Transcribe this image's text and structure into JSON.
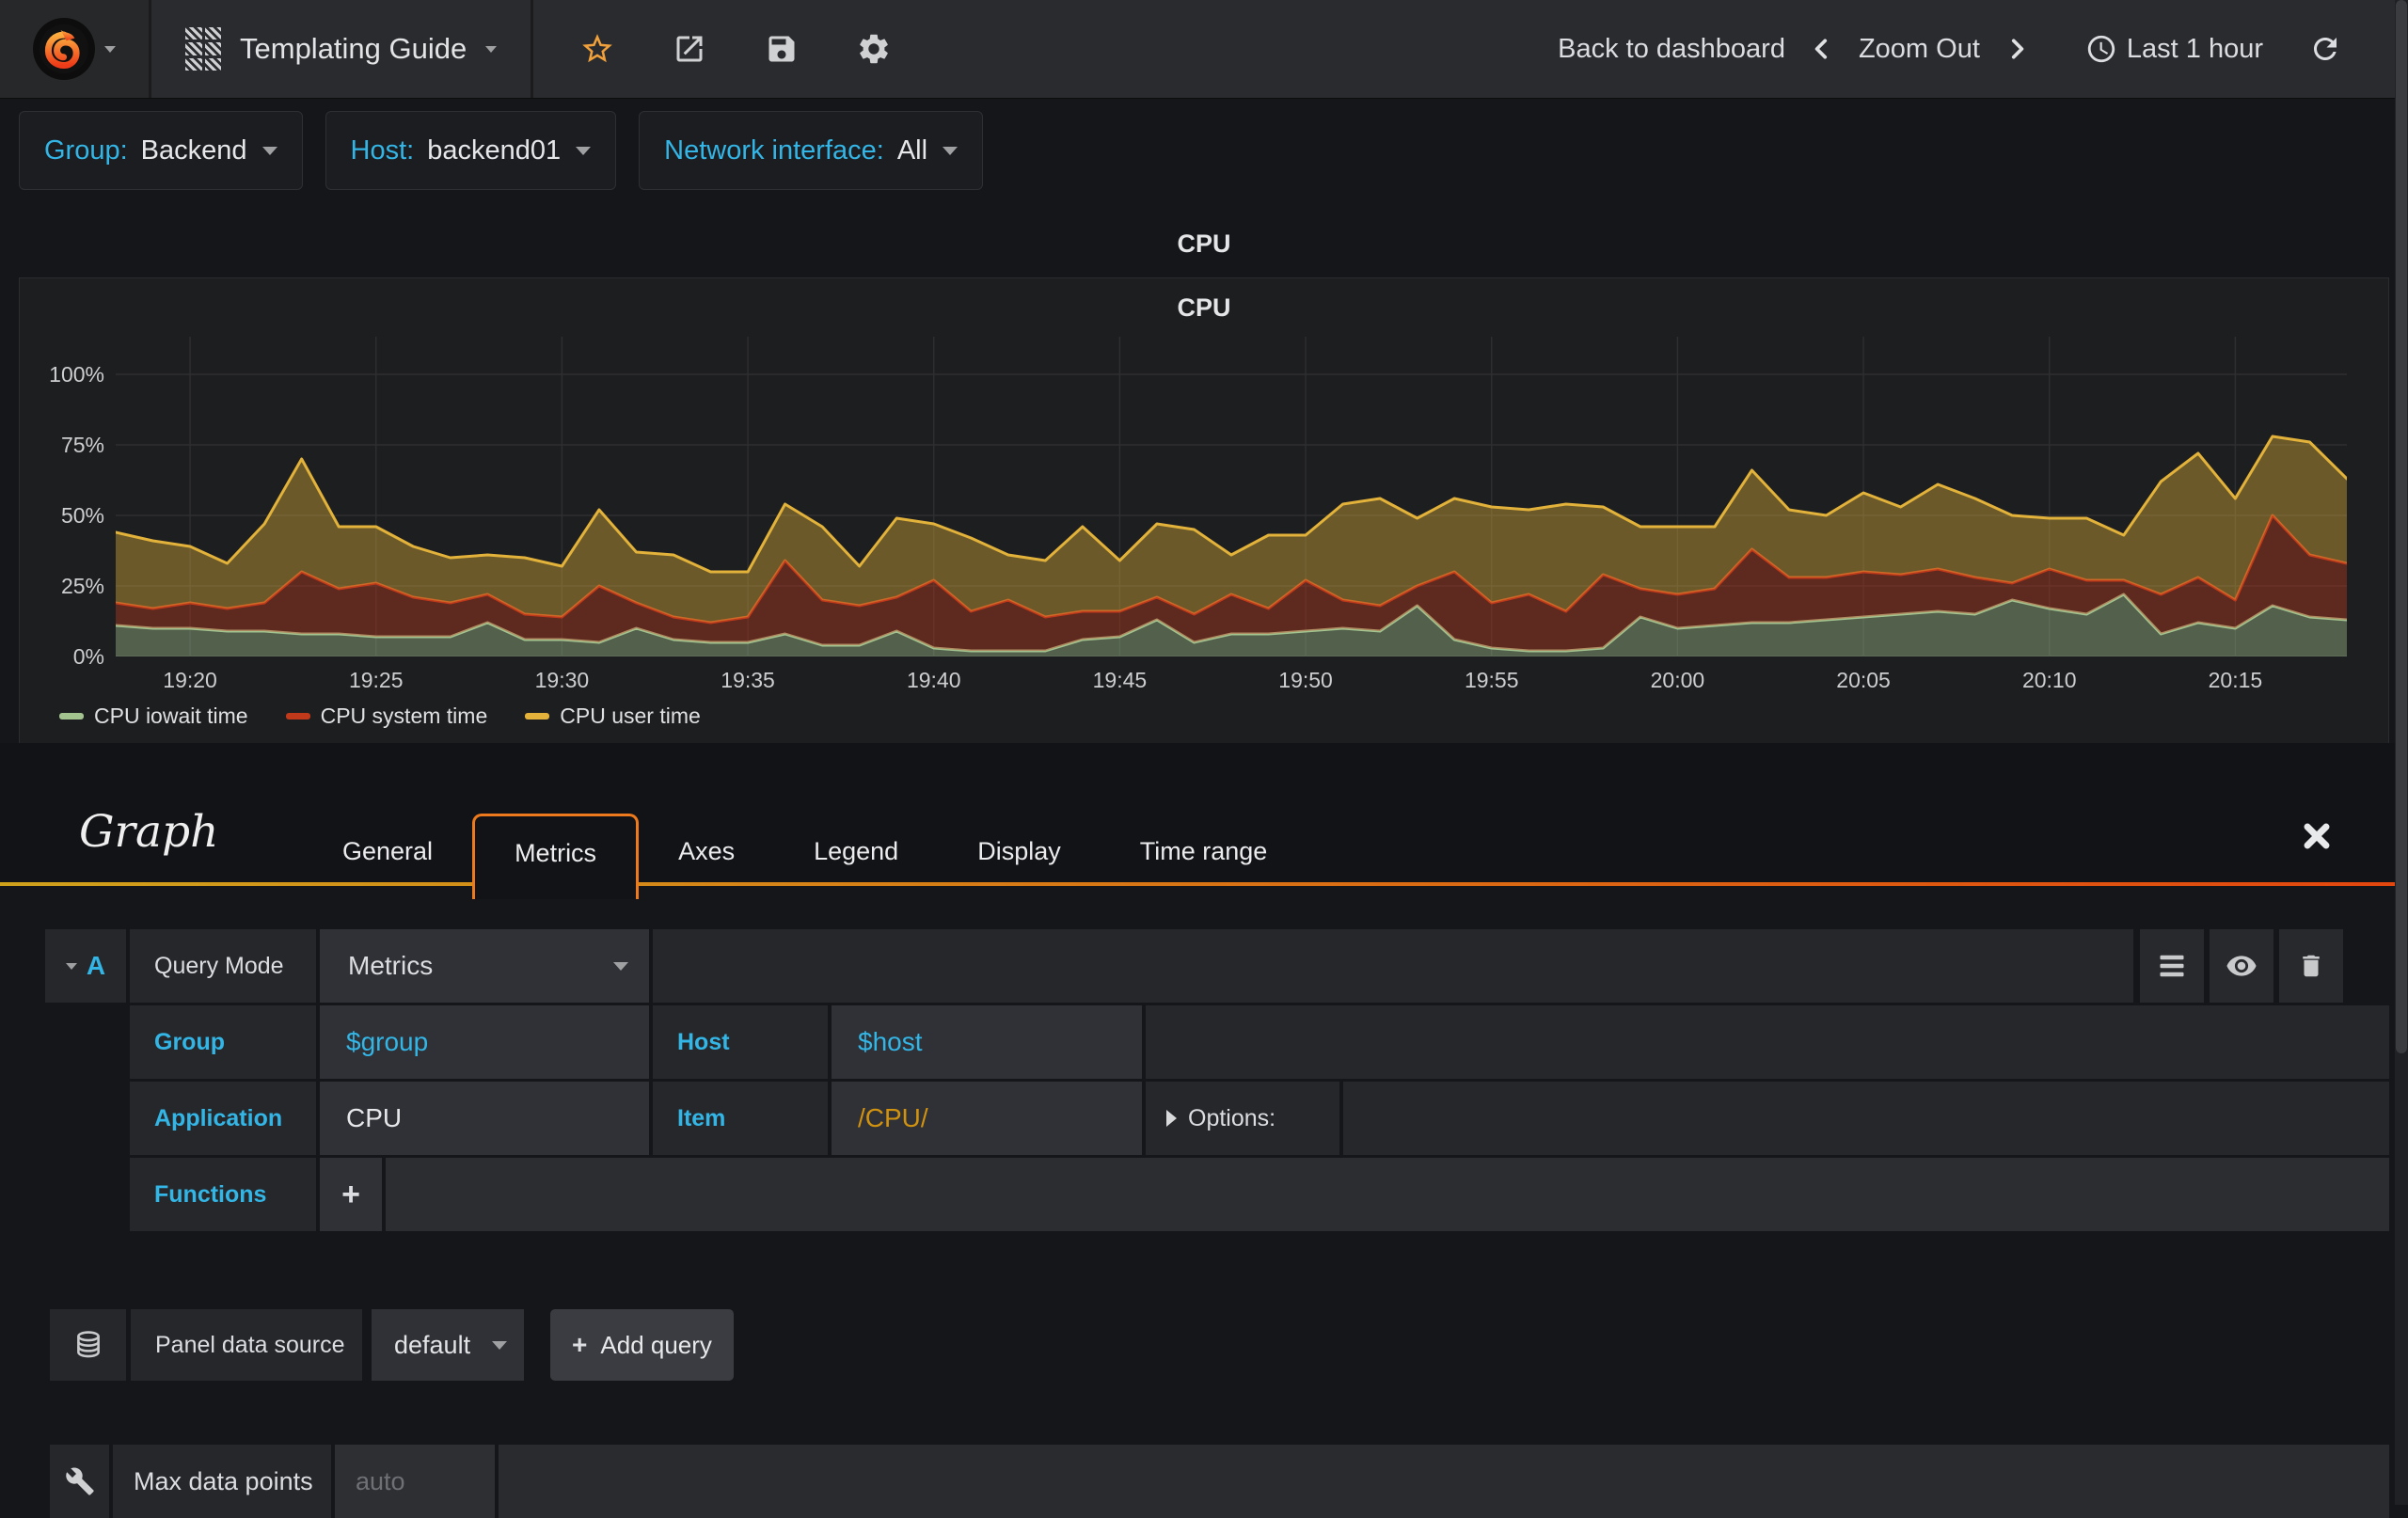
{
  "navbar": {
    "title": "Templating Guide",
    "back_to_dashboard": "Back to dashboard",
    "zoom_out": "Zoom Out",
    "time_range": "Last 1 hour"
  },
  "variables": [
    {
      "label": "Group:",
      "value": "Backend"
    },
    {
      "label": "Host:",
      "value": "backend01"
    },
    {
      "label": "Network interface:",
      "value": "All"
    }
  ],
  "panel": {
    "header_title": "CPU"
  },
  "chart_data": {
    "type": "area",
    "stacked": true,
    "title": "CPU",
    "xlabel": "",
    "ylabel": "",
    "ylim": [
      0,
      100
    ],
    "grid": true,
    "legend_position": "bottom-left",
    "x_start": "19:18",
    "x_end": "20:18",
    "step_minutes": 1,
    "duration_minutes": 60,
    "y_ticks": [
      {
        "v": 0,
        "label": "0%"
      },
      {
        "v": 25,
        "label": "25%"
      },
      {
        "v": 50,
        "label": "50%"
      },
      {
        "v": 75,
        "label": "75%"
      },
      {
        "v": 100,
        "label": "100%"
      }
    ],
    "x_ticks": [
      {
        "t": 2,
        "label": "19:20"
      },
      {
        "t": 7,
        "label": "19:25"
      },
      {
        "t": 12,
        "label": "19:30"
      },
      {
        "t": 17,
        "label": "19:35"
      },
      {
        "t": 22,
        "label": "19:40"
      },
      {
        "t": 27,
        "label": "19:45"
      },
      {
        "t": 32,
        "label": "19:50"
      },
      {
        "t": 37,
        "label": "19:55"
      },
      {
        "t": 42,
        "label": "20:00"
      },
      {
        "t": 47,
        "label": "20:05"
      },
      {
        "t": 52,
        "label": "20:10"
      },
      {
        "t": 57,
        "label": "20:15"
      }
    ],
    "series": [
      {
        "name": "CPU iowait time",
        "color": "#A3C48F",
        "values": [
          11,
          10,
          10,
          9,
          9,
          8,
          8,
          7,
          7,
          7,
          12,
          6,
          6,
          5,
          10,
          6,
          5,
          5,
          8,
          4,
          4,
          9,
          3,
          2,
          2,
          2,
          6,
          7,
          13,
          5,
          8,
          8,
          9,
          10,
          9,
          18,
          6,
          3,
          2,
          2,
          3,
          14,
          10,
          11,
          12,
          12,
          13,
          14,
          15,
          16,
          15,
          20,
          17,
          15,
          22,
          8,
          12,
          10,
          18,
          14,
          13
        ]
      },
      {
        "name": "CPU system time",
        "color": "#C0391B",
        "values": [
          8,
          7,
          9,
          8,
          10,
          22,
          16,
          19,
          14,
          12,
          10,
          9,
          8,
          20,
          9,
          8,
          7,
          9,
          26,
          16,
          14,
          12,
          24,
          14,
          18,
          12,
          10,
          9,
          8,
          10,
          14,
          9,
          18,
          10,
          9,
          7,
          24,
          16,
          20,
          14,
          26,
          10,
          12,
          13,
          26,
          16,
          15,
          16,
          14,
          15,
          13,
          6,
          14,
          12,
          5,
          14,
          16,
          10,
          32,
          22,
          20
        ]
      },
      {
        "name": "CPU user time",
        "color": "#E2B23A",
        "values": [
          25,
          24,
          20,
          16,
          28,
          40,
          22,
          20,
          18,
          16,
          14,
          20,
          18,
          27,
          18,
          22,
          18,
          16,
          20,
          26,
          14,
          28,
          20,
          26,
          16,
          20,
          30,
          18,
          26,
          30,
          14,
          26,
          16,
          34,
          38,
          24,
          26,
          34,
          30,
          38,
          24,
          22,
          24,
          22,
          28,
          24,
          22,
          28,
          24,
          30,
          28,
          24,
          18,
          22,
          16,
          40,
          44,
          36,
          28,
          40,
          30
        ]
      }
    ]
  },
  "editor": {
    "panel_type": "Graph",
    "tabs": [
      "General",
      "Metrics",
      "Axes",
      "Legend",
      "Display",
      "Time range"
    ],
    "active_tab": "Metrics",
    "query": {
      "letter": "A",
      "query_mode_label": "Query Mode",
      "query_mode_value": "Metrics",
      "group_label": "Group",
      "group_value": "$group",
      "host_label": "Host",
      "host_value": "$host",
      "application_label": "Application",
      "application_value": "CPU",
      "item_label": "Item",
      "item_value": "/CPU/",
      "options_label": "Options:",
      "functions_label": "Functions",
      "functions_add": "+"
    },
    "datasource": {
      "label": "Panel data source",
      "value": "default",
      "add_query_label": "Add query",
      "plus": "+"
    },
    "max_data_points": {
      "label": "Max data points",
      "placeholder": "auto"
    }
  },
  "colors": {
    "accent_blue": "#33b5e5",
    "tab_active_border": "#ed7a1c",
    "underline_gradient_left": "#cfa11b",
    "underline_gradient_right": "#e2470e",
    "star": "#f0a13c",
    "item_regex_orange": "#d0920f",
    "series_green": "#A3C48F",
    "series_red": "#C0391B",
    "series_yellow": "#E2B23A"
  }
}
